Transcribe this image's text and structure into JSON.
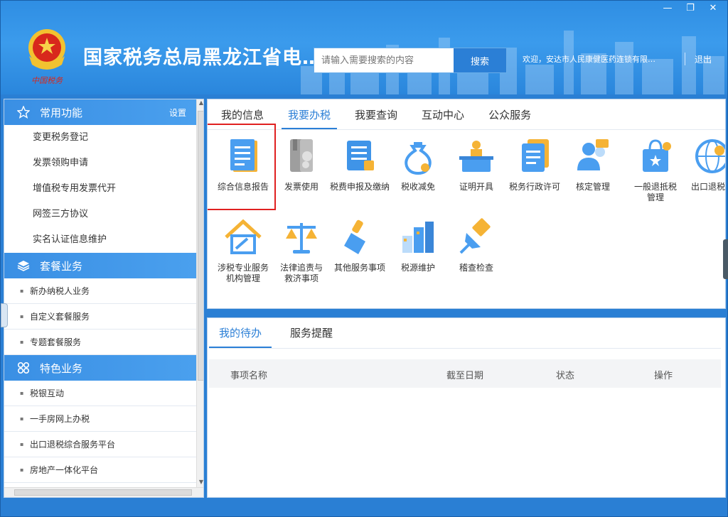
{
  "window": {
    "controls": [
      "—",
      "❐",
      "✕"
    ]
  },
  "header": {
    "title": "国家税务总局黑龙江省电…",
    "emblem_text": "中国税务",
    "search_placeholder": "请输入需要搜索的内容",
    "search_button": "搜索",
    "welcome": "欢迎，安达市人民康健医药连锁有限…",
    "logout": "退出"
  },
  "sidebar": {
    "common": {
      "label": "常用功能",
      "settings": "设置",
      "items": [
        "变更税务登记",
        "发票领购申请",
        "增值税专用发票代开",
        "网签三方协议",
        "实名认证信息维护"
      ]
    },
    "package": {
      "label": "套餐业务",
      "items": [
        "新办纳税人业务",
        "自定义套餐服务",
        "专题套餐服务"
      ]
    },
    "featured": {
      "label": "特色业务",
      "items": [
        "税银互动",
        "一手房网上办税",
        "出口退税综合服务平台",
        "房地产一体化平台"
      ]
    }
  },
  "main": {
    "tabs": [
      "我的信息",
      "我要办税",
      "我要查询",
      "互动中心",
      "公众服务"
    ],
    "active_tab": "我要办税",
    "tiles": [
      "综合信息报告",
      "发票使用",
      "税费申报及缴纳",
      "税收减免",
      "证明开具",
      "税务行政许可",
      "核定管理",
      "一般退抵税\n管理",
      "出口退税管",
      "涉税专业服务\n机构管理",
      "法律追责与\n救济事项",
      "其他服务事项",
      "税源维护",
      "稽查检查"
    ]
  },
  "tasks": {
    "tabs": [
      "我的待办",
      "服务提醒"
    ],
    "columns": [
      "事项名称",
      "截至日期",
      "状态",
      "操作"
    ]
  },
  "colors": {
    "accent": "#2b7fd6",
    "highlight": "#e02020",
    "header": "#2f8ee3"
  }
}
